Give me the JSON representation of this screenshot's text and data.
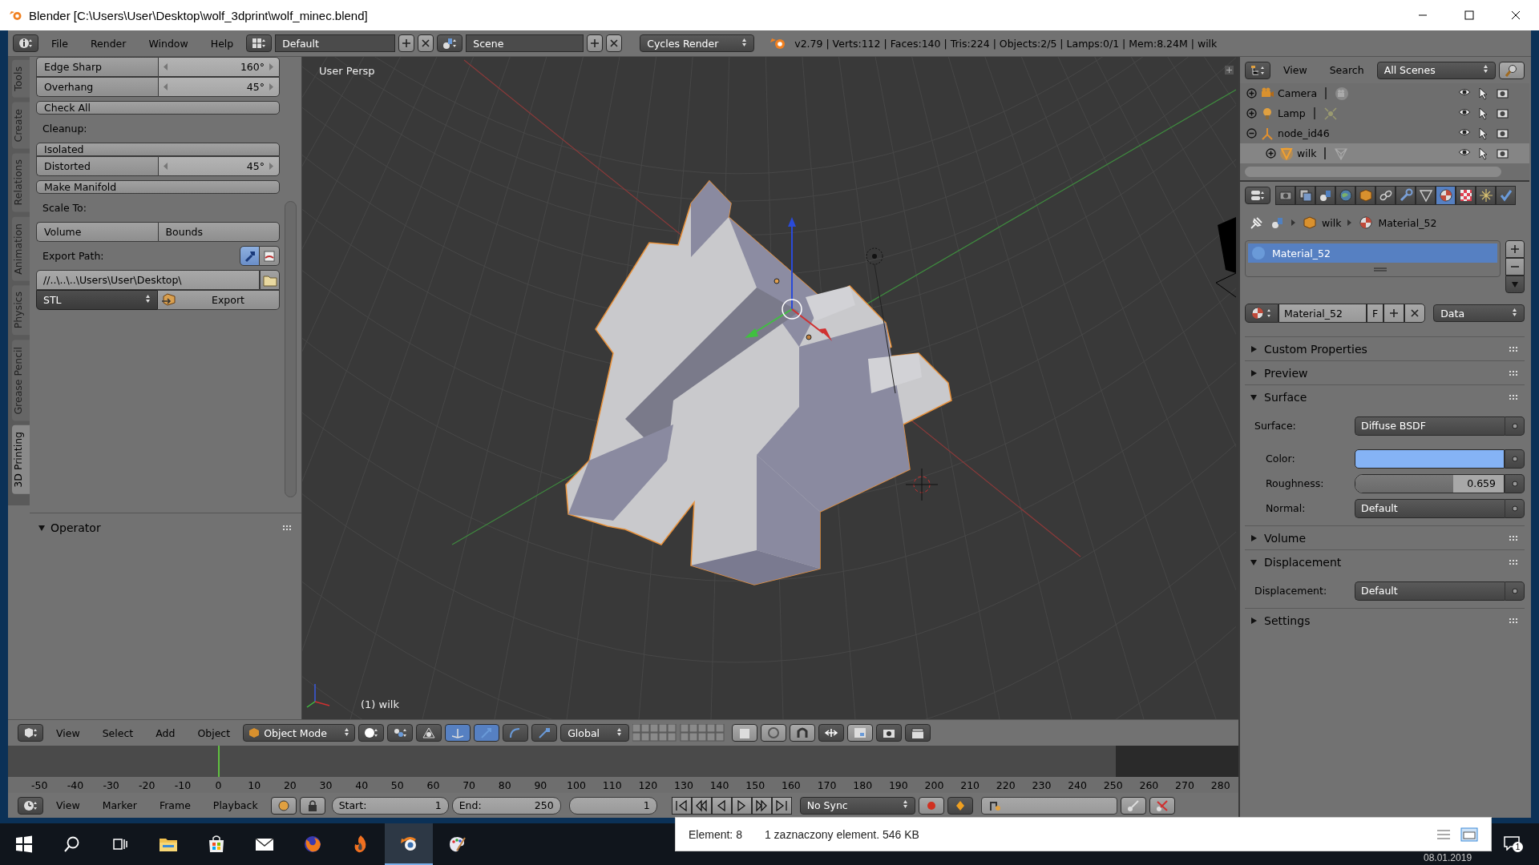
{
  "window": {
    "title": "Blender [C:\\Users\\User\\Desktop\\wolf_3dprint\\wolf_minec.blend]"
  },
  "info_header": {
    "menus": [
      "File",
      "Render",
      "Window",
      "Help"
    ],
    "layout": "Default",
    "scene": "Scene",
    "engine": "Cycles Render",
    "stats": "v2.79 | Verts:112 | Faces:140 | Tris:224 | Objects:2/5 | Lamps:0/1 | Mem:8.24M | wilk"
  },
  "tool_shelf": {
    "tabs": [
      {
        "label": "Tools",
        "selected": false
      },
      {
        "label": "Create",
        "selected": false
      },
      {
        "label": "Relations",
        "selected": false
      },
      {
        "label": "Animation",
        "selected": false
      },
      {
        "label": "Physics",
        "selected": false
      },
      {
        "label": "Grease Pencil",
        "selected": false
      },
      {
        "label": "3D Printing",
        "selected": true
      }
    ],
    "groups": [
      [
        {
          "kind": "slider",
          "label": "Edge Sharp",
          "value": "160°"
        },
        {
          "kind": "slider",
          "label": "Overhang",
          "value": "45°"
        }
      ],
      [
        {
          "kind": "button",
          "label": "Check All"
        }
      ],
      [
        {
          "kind": "heading",
          "label": "Cleanup:"
        }
      ],
      [
        {
          "kind": "button",
          "label": "Isolated"
        },
        {
          "kind": "slider",
          "label": "Distorted",
          "value": "45°"
        }
      ],
      [
        {
          "kind": "button",
          "label": "Make Manifold"
        }
      ],
      [
        {
          "kind": "heading",
          "label": "Scale To:"
        }
      ],
      [
        {
          "kind": "pair",
          "labels": [
            "Volume",
            "Bounds"
          ]
        }
      ],
      [
        {
          "kind": "path_heading",
          "label": "Export Path:"
        }
      ],
      [
        {
          "kind": "path",
          "value": "//..\\..\\..\\Users\\User\\Desktop\\"
        },
        {
          "kind": "export",
          "format": "STL",
          "label": "Export"
        }
      ]
    ],
    "operator": {
      "title": "Operator",
      "expanded": true
    }
  },
  "viewport": {
    "view_label": "User Persp",
    "object_label": "(1) wilk"
  },
  "view3d_header": {
    "menus": [
      "View",
      "Select",
      "Add",
      "Object"
    ],
    "mode": "Object Mode",
    "orientation": "Global"
  },
  "timeline": {
    "ticks": [
      "-50",
      "-40",
      "-30",
      "-20",
      "-10",
      "0",
      "10",
      "20",
      "30",
      "40",
      "50",
      "60",
      "70",
      "80",
      "90",
      "100",
      "110",
      "120",
      "130",
      "140",
      "150",
      "160",
      "170",
      "180",
      "190",
      "200",
      "210",
      "220",
      "230",
      "240",
      "250",
      "260",
      "270",
      "280"
    ],
    "frame_range": {
      "level": 0.9
    },
    "playhead": {
      "level": 0.171
    }
  },
  "timeline_header": {
    "menus": [
      "View",
      "Marker",
      "Frame",
      "Playback"
    ],
    "start_label": "Start:",
    "start_value": "1",
    "end_label": "End:",
    "end_value": "250",
    "frame": "1",
    "sync": "No Sync"
  },
  "outliner": {
    "menus": [
      "View",
      "Search"
    ],
    "filter": "All Scenes",
    "items": [
      {
        "name": "Camera",
        "kind": "camera",
        "expanded": false,
        "selected": false
      },
      {
        "name": "Lamp",
        "kind": "lamp",
        "expanded": false,
        "selected": false
      },
      {
        "name": "node_id46",
        "kind": "empty",
        "expanded": true,
        "selected": false,
        "children": [
          {
            "name": "wilk",
            "kind": "mesh",
            "expanded": false,
            "selected": true
          }
        ]
      }
    ]
  },
  "properties": {
    "tabs": [
      {
        "kind": "render",
        "selected": false
      },
      {
        "kind": "layers",
        "selected": false
      },
      {
        "kind": "scene",
        "selected": false
      },
      {
        "kind": "world",
        "selected": false
      },
      {
        "kind": "object",
        "selected": false
      },
      {
        "kind": "constraints",
        "selected": false
      },
      {
        "kind": "modifiers",
        "selected": false
      },
      {
        "kind": "data",
        "selected": false
      },
      {
        "kind": "material",
        "selected": true
      },
      {
        "kind": "texture",
        "selected": false
      },
      {
        "kind": "particles",
        "selected": false
      },
      {
        "kind": "physics",
        "selected": false
      }
    ],
    "breadcrumb": [
      "wilk",
      "Material_52"
    ],
    "slots": [
      {
        "name": "Material_52",
        "selected": true
      }
    ],
    "material": "Material_52",
    "fake_user": "F",
    "link": "Data",
    "panels": [
      {
        "title": "Custom Properties",
        "expanded": false
      },
      {
        "title": "Preview",
        "expanded": false
      },
      {
        "title": "Surface",
        "expanded": true,
        "rows": [
          {
            "kind": "dropdown",
            "label": "Surface:",
            "value": "Diffuse BSDF",
            "indent": false
          },
          {
            "kind": "color",
            "label": "Color:",
            "color": "#85b3f5"
          },
          {
            "kind": "slider",
            "label": "Roughness:",
            "value": "0.659",
            "level": 0.659
          },
          {
            "kind": "dropdown",
            "label": "Normal:",
            "value": "Default",
            "indent": true
          }
        ]
      },
      {
        "title": "Volume",
        "expanded": false
      },
      {
        "title": "Displacement",
        "expanded": true,
        "rows": [
          {
            "kind": "dropdown",
            "label": "Displacement:",
            "value": "Default",
            "indent": false
          }
        ]
      },
      {
        "title": "Settings",
        "expanded": false
      }
    ]
  },
  "taskbar": {
    "apps": [
      {
        "kind": "start",
        "selected": false
      },
      {
        "kind": "search",
        "selected": false
      },
      {
        "kind": "taskview",
        "selected": false
      },
      {
        "kind": "folder",
        "selected": false
      },
      {
        "kind": "store",
        "selected": false
      },
      {
        "kind": "mail",
        "selected": false
      },
      {
        "kind": "browser",
        "selected": false
      },
      {
        "kind": "flame",
        "selected": false
      },
      {
        "kind": "blender",
        "selected": true
      },
      {
        "kind": "paint",
        "selected": false
      }
    ],
    "tooltip": {
      "count": "Element: 8",
      "detail": "1 zaznaczony element. 546 KB"
    },
    "date": "08.01.2019",
    "notifications": "1"
  }
}
